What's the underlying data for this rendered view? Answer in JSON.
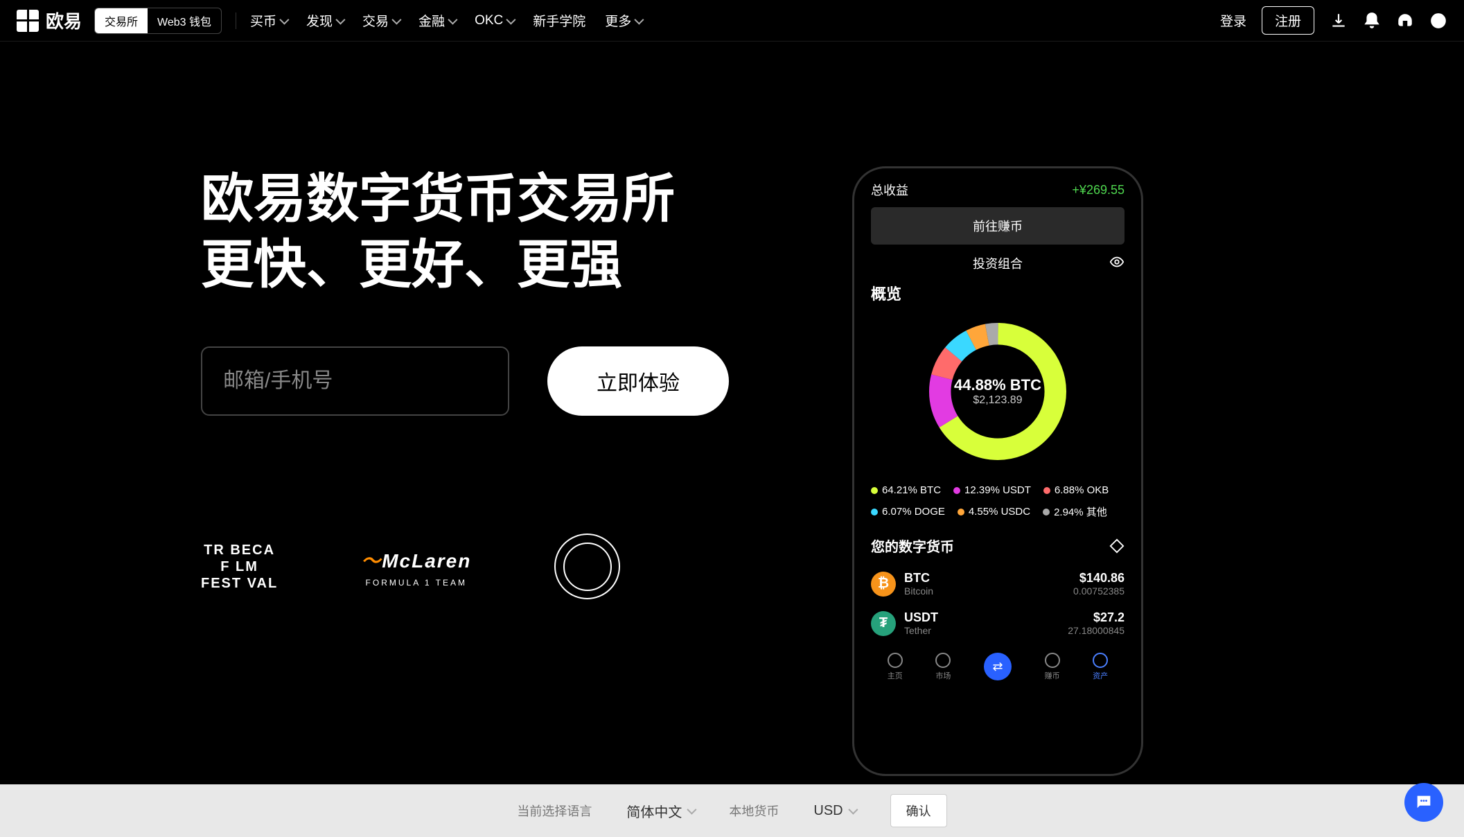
{
  "header": {
    "brand": "欧易",
    "toggle": {
      "exchange": "交易所",
      "wallet": "Web3 钱包"
    },
    "nav": [
      "买币",
      "发现",
      "交易",
      "金融",
      "OKC",
      "新手学院",
      "更多"
    ],
    "nav_dropdown": [
      true,
      true,
      true,
      true,
      true,
      false,
      true
    ],
    "login": "登录",
    "signup": "注册"
  },
  "hero": {
    "title_line1": "欧易数字货币交易所",
    "title_line2": "更快、更好、更强",
    "input_placeholder": "邮箱/手机号",
    "cta": "立即体验",
    "partners": {
      "tribeca": "TR BECA\nF LM\nFEST VAL",
      "mclaren_logo": "McLaren",
      "mclaren_sub": "FORMULA 1 TEAM"
    }
  },
  "phone": {
    "total_profit_label": "总收益",
    "total_profit_value": "+¥269.55",
    "earn_button": "前往赚币",
    "portfolio_label": "投资组合",
    "overview_label": "概览",
    "donut_center_pct": "44.88% BTC",
    "donut_center_amt": "$2,123.89",
    "legend": [
      {
        "pct": "64.21%",
        "sym": "BTC",
        "color": "#d8ff3a"
      },
      {
        "pct": "12.39%",
        "sym": "USDT",
        "color": "#e23be2"
      },
      {
        "pct": "6.88%",
        "sym": "OKB",
        "color": "#ff6b6b"
      },
      {
        "pct": "6.07%",
        "sym": "DOGE",
        "color": "#3ad8ff"
      },
      {
        "pct": "4.55%",
        "sym": "USDC",
        "color": "#ffa63a"
      },
      {
        "pct": "2.94%",
        "sym": "其他",
        "color": "#aaa"
      }
    ],
    "coins_label": "您的数字货币",
    "coins": [
      {
        "sym": "BTC",
        "name": "Bitcoin",
        "price": "$140.86",
        "amount": "0.00752385",
        "color": "#f7931a",
        "glyph": "₿"
      },
      {
        "sym": "USDT",
        "name": "Tether",
        "price": "$27.2",
        "amount": "27.18000845",
        "color": "#26a17b",
        "glyph": "₮"
      }
    ],
    "nav": [
      "主页",
      "市场",
      "",
      "赚币",
      "资产"
    ]
  },
  "bottom": {
    "lang_label": "当前选择语言",
    "lang_value": "简体中文",
    "currency_label": "本地货币",
    "currency_value": "USD",
    "confirm": "确认"
  },
  "chart_data": {
    "type": "pie",
    "title": "投资组合概览",
    "series": [
      {
        "name": "BTC",
        "value": 64.21,
        "color": "#d8ff3a"
      },
      {
        "name": "USDT",
        "value": 12.39,
        "color": "#e23be2"
      },
      {
        "name": "OKB",
        "value": 6.88,
        "color": "#ff6b6b"
      },
      {
        "name": "DOGE",
        "value": 6.07,
        "color": "#3ad8ff"
      },
      {
        "name": "USDC",
        "value": 4.55,
        "color": "#ffa63a"
      },
      {
        "name": "其他",
        "value": 2.94,
        "color": "#aaa"
      }
    ]
  }
}
